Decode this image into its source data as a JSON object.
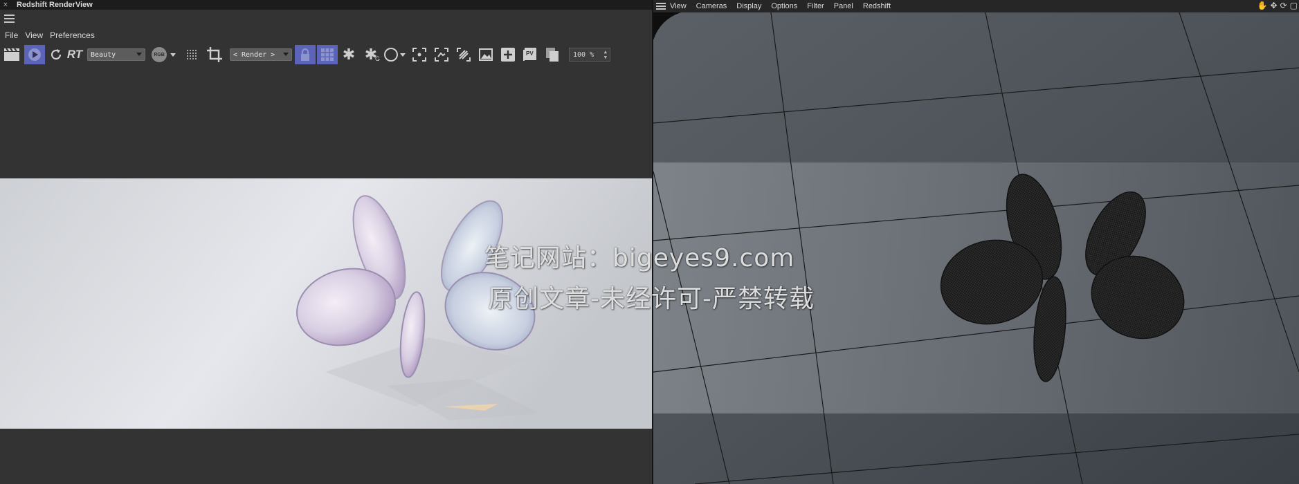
{
  "left_panel": {
    "title": "Redshift RenderView",
    "close_glyph": "×",
    "menu": [
      "File",
      "View",
      "Preferences"
    ],
    "toolbar": {
      "rt_label": "RT",
      "aov_select": "Beauty",
      "rgb_label": "RGB",
      "render_select": "< Render >",
      "zoom_value": "100 %",
      "icons": [
        "clapper-icon",
        "play-icon",
        "refresh-icon",
        "rt-icon",
        "rgb-icon",
        "dot-grid-icon",
        "crop-icon",
        "lock-icon",
        "grid-icon",
        "snowflake-icon",
        "snowflake-g-icon",
        "circle-icon",
        "focus-icon",
        "focus-frame-icon",
        "edit-icon",
        "image-icon",
        "add-snapshot-icon",
        "pv-icon",
        "copy-icon"
      ],
      "pv_label": "PV"
    }
  },
  "right_panel": {
    "menu": [
      "View",
      "Cameras",
      "Display",
      "Options",
      "Filter",
      "Panel",
      "Redshift"
    ],
    "nav_icons": [
      "hand-icon",
      "move-icon",
      "rotate-icon",
      "maximize-icon"
    ]
  },
  "watermark": {
    "line1": "笔记网站：bigeyes9.com",
    "line2": "原创文章-未经许可-严禁转载"
  },
  "colors": {
    "accent": "#5b64b8",
    "panel_bg": "#333333",
    "viewport_bg": "#4a5056"
  }
}
